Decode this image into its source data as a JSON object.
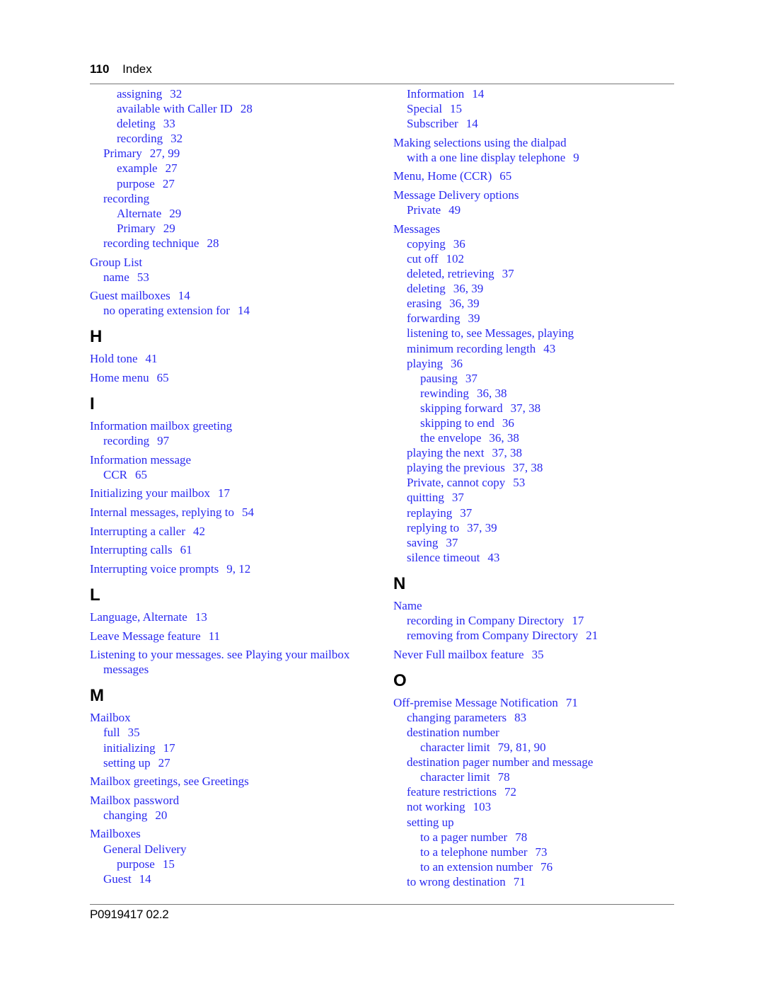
{
  "header": {
    "page_number": "110",
    "section": "Index"
  },
  "footer": {
    "doc_id": "P0919417 02.2"
  },
  "left_column": [
    {
      "level": 2,
      "term": "assigning",
      "pages": "32"
    },
    {
      "level": 2,
      "term": "available with Caller ID",
      "pages": "28"
    },
    {
      "level": 2,
      "term": "deleting",
      "pages": "33"
    },
    {
      "level": 2,
      "term": "recording",
      "pages": "32"
    },
    {
      "level": 1,
      "term": "Primary",
      "pages": "27, 99"
    },
    {
      "level": 2,
      "term": "example",
      "pages": "27"
    },
    {
      "level": 2,
      "term": "purpose",
      "pages": "27"
    },
    {
      "level": 1,
      "term": "recording",
      "pages": ""
    },
    {
      "level": 2,
      "term": "Alternate",
      "pages": "29"
    },
    {
      "level": 2,
      "term": "Primary",
      "pages": "29"
    },
    {
      "level": 1,
      "term": "recording technique",
      "pages": "28"
    },
    {
      "level": 0,
      "term": "Group List",
      "pages": ""
    },
    {
      "level": 1,
      "term": "name",
      "pages": "53"
    },
    {
      "level": 0,
      "term": "Guest mailboxes",
      "pages": "14"
    },
    {
      "level": 1,
      "term": "no operating extension for",
      "pages": "14"
    },
    {
      "letter": "H"
    },
    {
      "level": 0,
      "term": "Hold tone",
      "pages": "41"
    },
    {
      "level": 0,
      "term": "Home menu",
      "pages": "65"
    },
    {
      "letter": "I"
    },
    {
      "level": 0,
      "term": "Information mailbox greeting",
      "pages": ""
    },
    {
      "level": 1,
      "term": "recording",
      "pages": "97"
    },
    {
      "level": 0,
      "term": "Information message",
      "pages": ""
    },
    {
      "level": 1,
      "term": "CCR",
      "pages": "65"
    },
    {
      "level": 0,
      "term": "Initializing your mailbox",
      "pages": "17"
    },
    {
      "level": 0,
      "term": "Internal messages, replying to",
      "pages": "54"
    },
    {
      "level": 0,
      "term": "Interrupting a caller",
      "pages": "42"
    },
    {
      "level": 0,
      "term": "Interrupting calls",
      "pages": "61"
    },
    {
      "level": 0,
      "term": "Interrupting voice prompts",
      "pages": "9, 12"
    },
    {
      "letter": "L"
    },
    {
      "level": 0,
      "term": "Language, Alternate",
      "pages": "13"
    },
    {
      "level": 0,
      "term": "Leave Message feature",
      "pages": "11"
    },
    {
      "level": 0,
      "term": "Listening to your messages. see Playing your mailbox messages",
      "pages": "",
      "wrap": true
    },
    {
      "letter": "M"
    },
    {
      "level": 0,
      "term": "Mailbox",
      "pages": ""
    },
    {
      "level": 1,
      "term": "full",
      "pages": "35"
    },
    {
      "level": 1,
      "term": "initializing",
      "pages": "17"
    },
    {
      "level": 1,
      "term": "setting up",
      "pages": "27"
    },
    {
      "level": 0,
      "term": "Mailbox greetings, see Greetings",
      "pages": ""
    },
    {
      "level": 0,
      "term": "Mailbox password",
      "pages": ""
    },
    {
      "level": 1,
      "term": "changing",
      "pages": "20"
    },
    {
      "level": 0,
      "term": "Mailboxes",
      "pages": ""
    },
    {
      "level": 1,
      "term": "General Delivery",
      "pages": ""
    },
    {
      "level": 2,
      "term": "purpose",
      "pages": "15"
    },
    {
      "level": 1,
      "term": "Guest",
      "pages": "14"
    }
  ],
  "right_column": [
    {
      "level": 1,
      "term": "Information",
      "pages": "14"
    },
    {
      "level": 1,
      "term": "Special",
      "pages": "15"
    },
    {
      "level": 1,
      "term": "Subscriber",
      "pages": "14"
    },
    {
      "level": 0,
      "term": "Making selections using the dialpad",
      "pages": ""
    },
    {
      "level": 1,
      "term": "with a one line display telephone",
      "pages": "9"
    },
    {
      "level": 0,
      "term": "Menu, Home (CCR)",
      "pages": "65"
    },
    {
      "level": 0,
      "term": "Message Delivery options",
      "pages": ""
    },
    {
      "level": 1,
      "term": "Private",
      "pages": "49"
    },
    {
      "level": 0,
      "term": "Messages",
      "pages": ""
    },
    {
      "level": 1,
      "term": "copying",
      "pages": "36"
    },
    {
      "level": 1,
      "term": "cut off",
      "pages": "102"
    },
    {
      "level": 1,
      "term": "deleted, retrieving",
      "pages": "37"
    },
    {
      "level": 1,
      "term": "deleting",
      "pages": "36, 39"
    },
    {
      "level": 1,
      "term": "erasing",
      "pages": "36, 39"
    },
    {
      "level": 1,
      "term": "forwarding",
      "pages": "39"
    },
    {
      "level": 1,
      "term": "listening to, see Messages, playing",
      "pages": ""
    },
    {
      "level": 1,
      "term": "minimum recording length",
      "pages": "43"
    },
    {
      "level": 1,
      "term": "playing",
      "pages": "36"
    },
    {
      "level": 2,
      "term": "pausing",
      "pages": "37"
    },
    {
      "level": 2,
      "term": "rewinding",
      "pages": "36, 38"
    },
    {
      "level": 2,
      "term": "skipping forward",
      "pages": "37, 38"
    },
    {
      "level": 2,
      "term": "skipping to end",
      "pages": "36"
    },
    {
      "level": 2,
      "term": "the envelope",
      "pages": "36, 38"
    },
    {
      "level": 1,
      "term": "playing the next",
      "pages": "37, 38"
    },
    {
      "level": 1,
      "term": "playing the previous",
      "pages": "37, 38"
    },
    {
      "level": 1,
      "term": "Private, cannot copy",
      "pages": "53"
    },
    {
      "level": 1,
      "term": "quitting",
      "pages": "37"
    },
    {
      "level": 1,
      "term": "replaying",
      "pages": "37"
    },
    {
      "level": 1,
      "term": "replying to",
      "pages": "37, 39"
    },
    {
      "level": 1,
      "term": "saving",
      "pages": "37"
    },
    {
      "level": 1,
      "term": "silence timeout",
      "pages": "43"
    },
    {
      "letter": "N"
    },
    {
      "level": 0,
      "term": "Name",
      "pages": ""
    },
    {
      "level": 1,
      "term": "recording in Company Directory",
      "pages": "17"
    },
    {
      "level": 1,
      "term": "removing from Company Directory",
      "pages": "21"
    },
    {
      "level": 0,
      "term": "Never Full mailbox feature",
      "pages": "35"
    },
    {
      "letter": "O"
    },
    {
      "level": 0,
      "term": "Off-premise Message Notification",
      "pages": "71"
    },
    {
      "level": 1,
      "term": "changing parameters",
      "pages": "83"
    },
    {
      "level": 1,
      "term": "destination number",
      "pages": ""
    },
    {
      "level": 2,
      "term": "character limit",
      "pages": "79, 81, 90"
    },
    {
      "level": 1,
      "term": "destination pager number and message",
      "pages": ""
    },
    {
      "level": 2,
      "term": "character limit",
      "pages": "78"
    },
    {
      "level": 1,
      "term": "feature restrictions",
      "pages": "72"
    },
    {
      "level": 1,
      "term": "not working",
      "pages": "103"
    },
    {
      "level": 1,
      "term": "setting up",
      "pages": ""
    },
    {
      "level": 2,
      "term": "to a pager number",
      "pages": "78"
    },
    {
      "level": 2,
      "term": "to a telephone number",
      "pages": "73"
    },
    {
      "level": 2,
      "term": "to an extension number",
      "pages": "76"
    },
    {
      "level": 1,
      "term": "to wrong destination",
      "pages": "71"
    }
  ]
}
